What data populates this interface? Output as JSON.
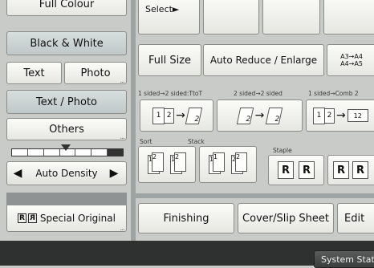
{
  "left_panel": {
    "full_colour": "Full Colour",
    "black_white": "Black & White",
    "text": "Text",
    "photo": "Photo",
    "text_photo": "Text / Photo",
    "others": "Others",
    "auto_density": "Auto Density",
    "special_original": "Special Original",
    "dots": "..."
  },
  "top_row": {
    "select": "Select►"
  },
  "reduce_row": {
    "full_size": "Full Size",
    "auto_reduce": "Auto Reduce / Enlarge",
    "ratio_top": "A3→A4",
    "ratio_bottom": "A4→A5"
  },
  "duplex_row": {
    "label1": "1 sided→2 sided:TtoT",
    "label2": "2 sided→2 sided",
    "label3": "1 sided→Comb 2"
  },
  "finish_row": {
    "sort": "Sort",
    "stack": "Stack",
    "staple": "Staple"
  },
  "bottom_tabs": {
    "finishing": "Finishing",
    "cover_slip": "Cover/Slip Sheet",
    "edit": "Edit"
  },
  "status_bar": {
    "system_status": "System Statu"
  },
  "colors": {
    "background": "#c9cbc8",
    "status_bar": "#2f3030",
    "gap": "#9ea3a3"
  }
}
